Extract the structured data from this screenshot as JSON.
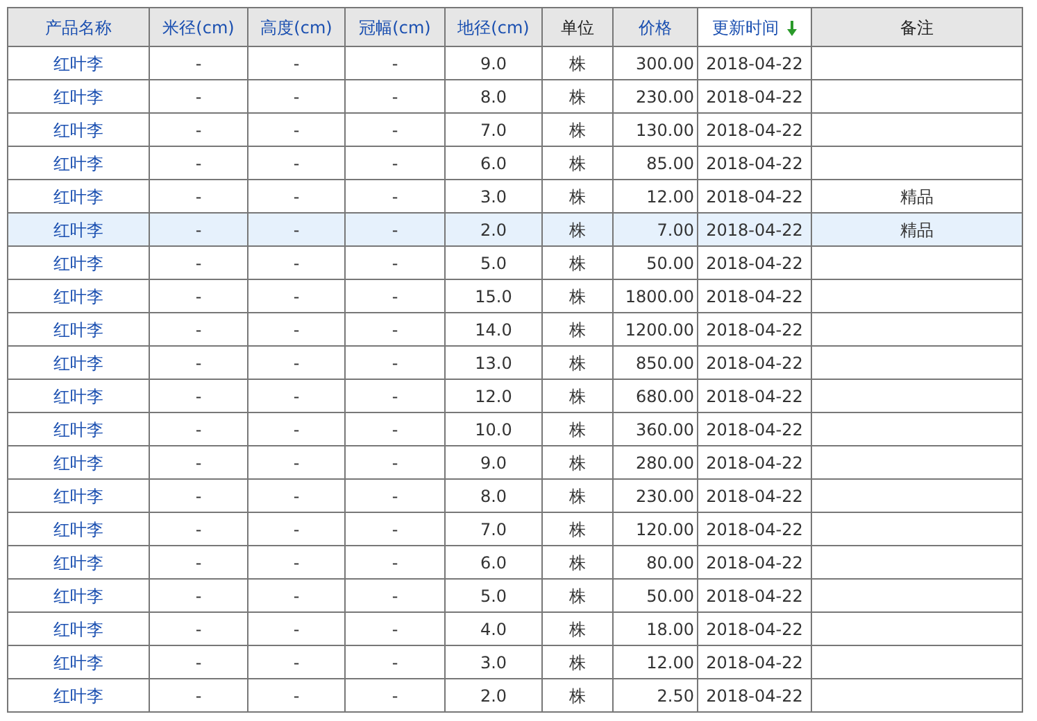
{
  "table": {
    "columns": [
      {
        "label": "产品名称",
        "sortable": true,
        "selected": false
      },
      {
        "label": "米径(cm)",
        "sortable": true,
        "selected": false
      },
      {
        "label": "高度(cm)",
        "sortable": true,
        "selected": false
      },
      {
        "label": "冠幅(cm)",
        "sortable": true,
        "selected": false
      },
      {
        "label": "地径(cm)",
        "sortable": true,
        "selected": false
      },
      {
        "label": "单位",
        "sortable": false,
        "selected": false
      },
      {
        "label": "价格",
        "sortable": true,
        "selected": false
      },
      {
        "label": "更新时间",
        "sortable": true,
        "selected": true
      },
      {
        "label": "备注",
        "sortable": false,
        "selected": false
      }
    ],
    "rows": [
      {
        "selected": false,
        "cells": [
          "红叶李",
          "-",
          "-",
          "-",
          "9.0",
          "株",
          "300.00",
          "2018-04-22",
          ""
        ]
      },
      {
        "selected": false,
        "cells": [
          "红叶李",
          "-",
          "-",
          "-",
          "8.0",
          "株",
          "230.00",
          "2018-04-22",
          ""
        ]
      },
      {
        "selected": false,
        "cells": [
          "红叶李",
          "-",
          "-",
          "-",
          "7.0",
          "株",
          "130.00",
          "2018-04-22",
          ""
        ]
      },
      {
        "selected": false,
        "cells": [
          "红叶李",
          "-",
          "-",
          "-",
          "6.0",
          "株",
          "85.00",
          "2018-04-22",
          ""
        ]
      },
      {
        "selected": false,
        "cells": [
          "红叶李",
          "-",
          "-",
          "-",
          "3.0",
          "株",
          "12.00",
          "2018-04-22",
          "精品"
        ]
      },
      {
        "selected": true,
        "cells": [
          "红叶李",
          "-",
          "-",
          "-",
          "2.0",
          "株",
          "7.00",
          "2018-04-22",
          "精品"
        ]
      },
      {
        "selected": false,
        "cells": [
          "红叶李",
          "-",
          "-",
          "-",
          "5.0",
          "株",
          "50.00",
          "2018-04-22",
          ""
        ]
      },
      {
        "selected": false,
        "cells": [
          "红叶李",
          "-",
          "-",
          "-",
          "15.0",
          "株",
          "1800.00",
          "2018-04-22",
          ""
        ]
      },
      {
        "selected": false,
        "cells": [
          "红叶李",
          "-",
          "-",
          "-",
          "14.0",
          "株",
          "1200.00",
          "2018-04-22",
          ""
        ]
      },
      {
        "selected": false,
        "cells": [
          "红叶李",
          "-",
          "-",
          "-",
          "13.0",
          "株",
          "850.00",
          "2018-04-22",
          ""
        ]
      },
      {
        "selected": false,
        "cells": [
          "红叶李",
          "-",
          "-",
          "-",
          "12.0",
          "株",
          "680.00",
          "2018-04-22",
          ""
        ]
      },
      {
        "selected": false,
        "cells": [
          "红叶李",
          "-",
          "-",
          "-",
          "10.0",
          "株",
          "360.00",
          "2018-04-22",
          ""
        ]
      },
      {
        "selected": false,
        "cells": [
          "红叶李",
          "-",
          "-",
          "-",
          "9.0",
          "株",
          "280.00",
          "2018-04-22",
          ""
        ]
      },
      {
        "selected": false,
        "cells": [
          "红叶李",
          "-",
          "-",
          "-",
          "8.0",
          "株",
          "230.00",
          "2018-04-22",
          ""
        ]
      },
      {
        "selected": false,
        "cells": [
          "红叶李",
          "-",
          "-",
          "-",
          "7.0",
          "株",
          "120.00",
          "2018-04-22",
          ""
        ]
      },
      {
        "selected": false,
        "cells": [
          "红叶李",
          "-",
          "-",
          "-",
          "6.0",
          "株",
          "80.00",
          "2018-04-22",
          ""
        ]
      },
      {
        "selected": false,
        "cells": [
          "红叶李",
          "-",
          "-",
          "-",
          "5.0",
          "株",
          "50.00",
          "2018-04-22",
          ""
        ]
      },
      {
        "selected": false,
        "cells": [
          "红叶李",
          "-",
          "-",
          "-",
          "4.0",
          "株",
          "18.00",
          "2018-04-22",
          ""
        ]
      },
      {
        "selected": false,
        "cells": [
          "红叶李",
          "-",
          "-",
          "-",
          "3.0",
          "株",
          "12.00",
          "2018-04-22",
          ""
        ]
      },
      {
        "selected": false,
        "cells": [
          "红叶李",
          "-",
          "-",
          "-",
          "2.0",
          "株",
          "2.50",
          "2018-04-22",
          ""
        ]
      }
    ]
  }
}
